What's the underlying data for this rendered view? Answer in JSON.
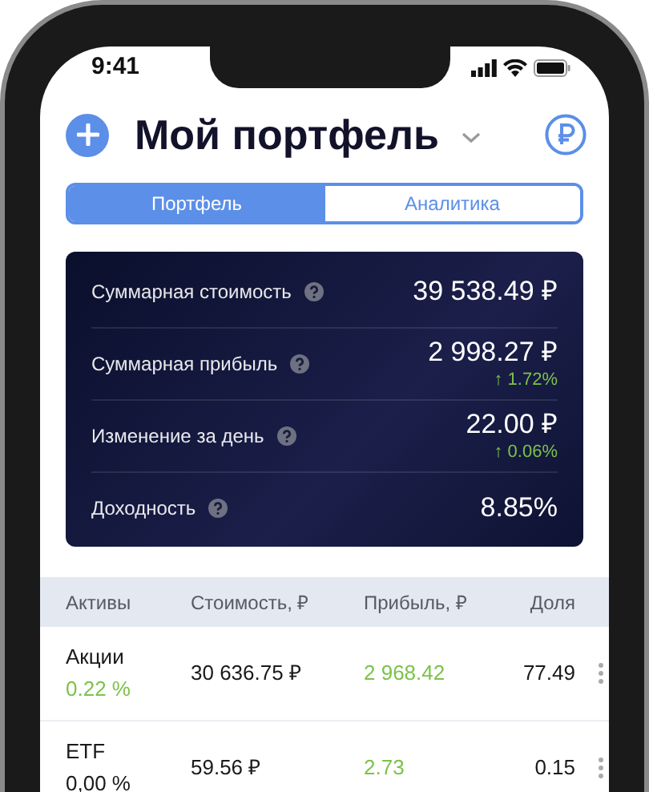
{
  "status_bar": {
    "time": "9:41"
  },
  "header": {
    "title": "Мой портфель"
  },
  "tabs": [
    {
      "label": "Портфель",
      "selected": true
    },
    {
      "label": "Аналитика",
      "selected": false
    }
  ],
  "summary": [
    {
      "label": "Суммарная стоимость",
      "value": "39 538.49 ₽"
    },
    {
      "label": "Суммарная прибыль",
      "value": "2 998.27 ₽",
      "change": "↑ 1.72%",
      "positive": true
    },
    {
      "label": "Изменение за день",
      "value": "22.00 ₽",
      "change": "↑ 0.06%",
      "positive": true
    },
    {
      "label": "Доходность",
      "value": "8.85%"
    }
  ],
  "table": {
    "columns": [
      "Активы",
      "Стоимость, ₽",
      "Прибыль, ₽",
      "Доля"
    ],
    "rows": [
      {
        "asset": "Акции",
        "change": "0.22 %",
        "change_positive": true,
        "value": "30 636.75 ₽",
        "profit": "2 968.42",
        "profit_positive": true,
        "share": "77.49"
      },
      {
        "asset": "ETF",
        "change": "0,00 %",
        "change_positive": false,
        "value": "59.56 ₽",
        "profit": "2.73",
        "profit_positive": true,
        "share": "0.15"
      }
    ]
  }
}
